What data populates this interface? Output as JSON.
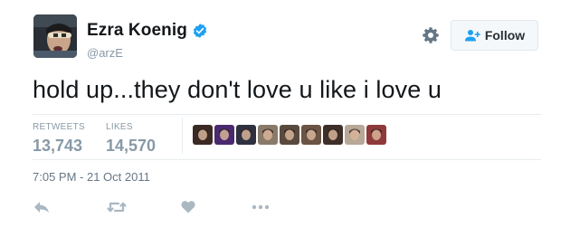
{
  "author": {
    "display_name": "Ezra Koenig",
    "handle": "@arzE",
    "verified": true,
    "avatar_icon": "avatar-photo"
  },
  "header": {
    "settings_icon": "gear-icon",
    "follow_label": "Follow",
    "follow_icon": "add-user-icon"
  },
  "tweet": {
    "text": "hold up...they don't love u like i love u",
    "timestamp": "7:05 PM - 21 Oct 2011"
  },
  "stats": {
    "retweets_label": "RETWEETS",
    "retweets_value": "13,743",
    "likes_label": "LIKES",
    "likes_value": "14,570"
  },
  "likers": [
    {
      "icon": "liker-avatar-1",
      "color": "#3b2a24"
    },
    {
      "icon": "liker-avatar-2",
      "color": "#4a2a6e"
    },
    {
      "icon": "liker-avatar-3",
      "color": "#2f3140"
    },
    {
      "icon": "liker-avatar-4",
      "color": "#8a7a6a"
    },
    {
      "icon": "liker-avatar-5",
      "color": "#5a4a3e"
    },
    {
      "icon": "liker-avatar-6",
      "color": "#6b5443"
    },
    {
      "icon": "liker-avatar-7",
      "color": "#3e2e28"
    },
    {
      "icon": "liker-avatar-8",
      "color": "#b8a898"
    },
    {
      "icon": "liker-avatar-9",
      "color": "#8e3a3a"
    }
  ],
  "actions": [
    "reply-icon",
    "retweet-icon",
    "like-icon",
    "more-icon"
  ],
  "colors": {
    "verified_blue": "#1da1f2",
    "muted": "#8899a6",
    "action_gray": "#aab8c2",
    "follow_icon_blue": "#1da1f2"
  }
}
